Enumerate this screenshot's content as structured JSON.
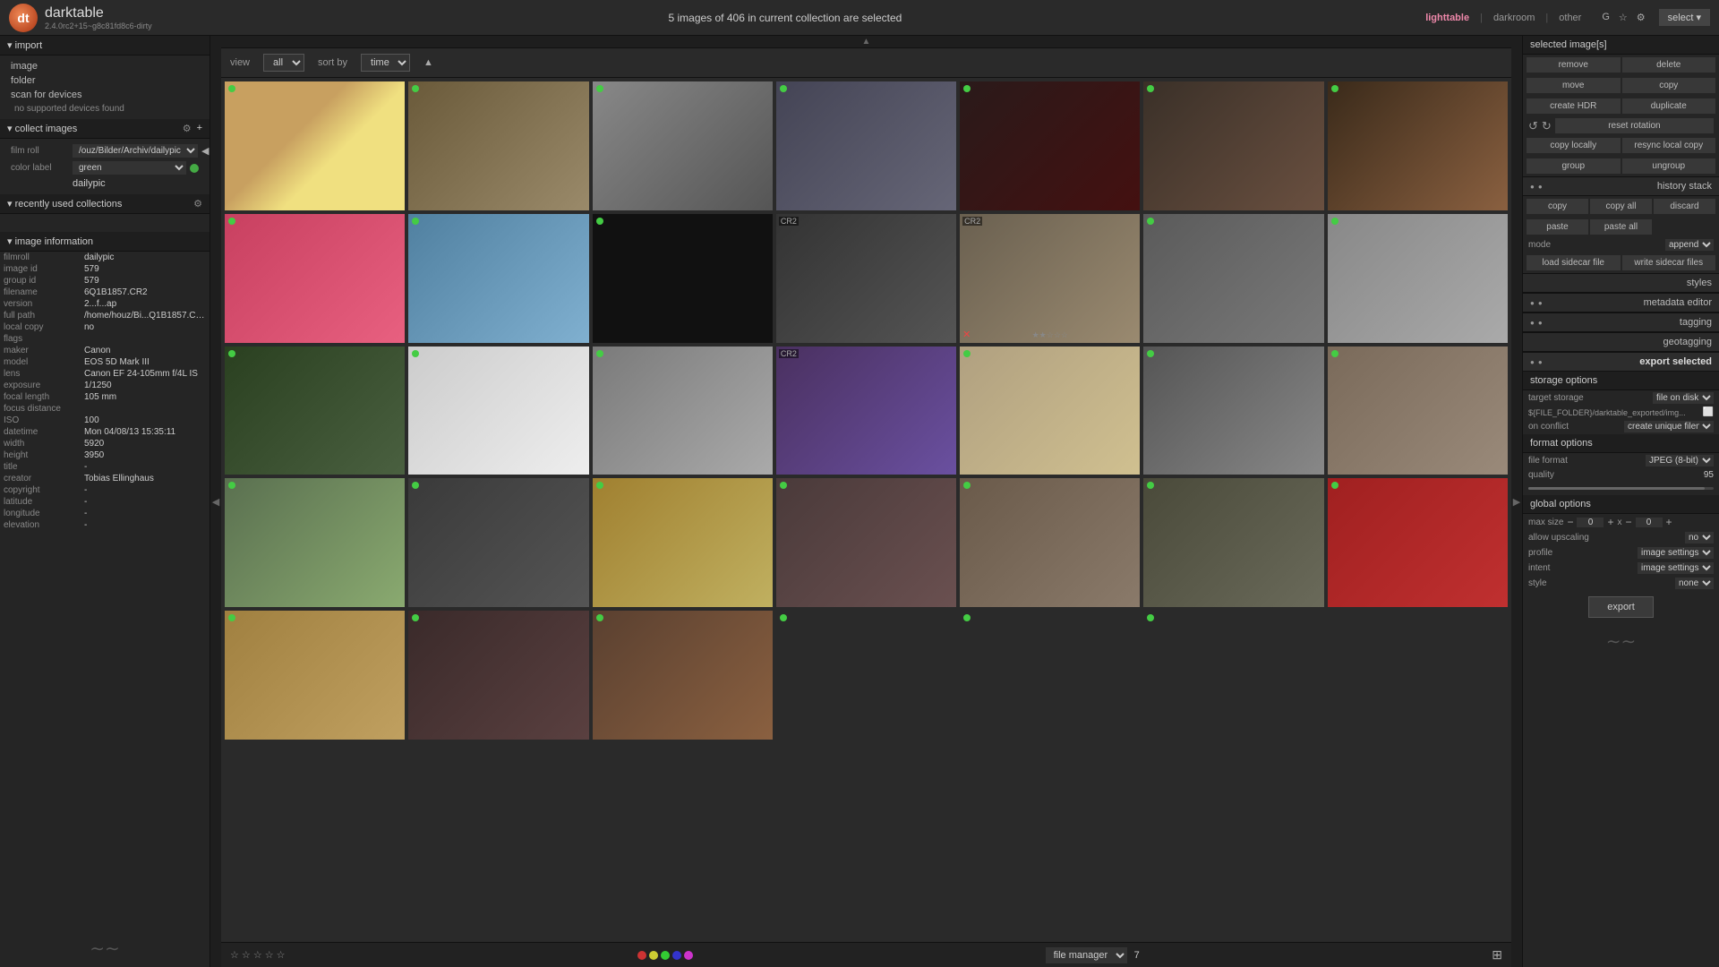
{
  "app": {
    "name": "darktable",
    "version": "2.4.0rc2+15~g8c81fd8c6-dirty"
  },
  "topbar": {
    "center": "5 images of 406 in current collection are selected",
    "modules": [
      "lighttable",
      "darkroom",
      "other"
    ],
    "active_module": "lighttable",
    "select_label": "select ▾"
  },
  "toolbar": {
    "view_label": "view",
    "view_value": "all",
    "sort_label": "sort by",
    "sort_value": "time"
  },
  "left": {
    "import_header": "▾ import",
    "import_items": [
      "image",
      "folder",
      "scan for devices",
      "no supported devices found"
    ],
    "collect_header": "▾ collect images",
    "film_roll_label": "film roll",
    "film_roll_value": "▾ /ouz/Bilder/Archiv/dailypic",
    "color_label_label": "color label",
    "color_label_value": "green",
    "tag_value": "dailypic",
    "recent_header": "▾ recently used collections",
    "image_info_header": "▾ image information",
    "info": {
      "filmroll": {
        "label": "filmroll",
        "value": "dailypic"
      },
      "image_id": {
        "label": "image id",
        "value": "579"
      },
      "group_id": {
        "label": "group id",
        "value": "579"
      },
      "filename": {
        "label": "filename",
        "value": "6Q1B1857.CR2"
      },
      "version": {
        "label": "version",
        "value": "2...f...ap"
      },
      "full_path": {
        "label": "full path",
        "value": "/home/houz/Bi...Q1B1857.CR2"
      },
      "local_copy": {
        "label": "local copy",
        "value": "no"
      },
      "flags": {
        "label": "flags",
        "value": ""
      },
      "maker": {
        "label": "maker",
        "value": "Canon"
      },
      "model": {
        "label": "model",
        "value": "EOS 5D Mark III"
      },
      "lens": {
        "label": "lens",
        "value": "Canon EF 24-105mm f/4L IS"
      },
      "exposure": {
        "label": "exposure",
        "value": "1/1250"
      },
      "focal_length": {
        "label": "focal length",
        "value": "105 mm"
      },
      "focus_distance": {
        "label": "focus distance",
        "value": ""
      },
      "iso": {
        "label": "ISO",
        "value": "100"
      },
      "datetime": {
        "label": "datetime",
        "value": "Mon 04/08/13 15:35:11"
      },
      "width": {
        "label": "width",
        "value": "5920"
      },
      "height": {
        "label": "height",
        "value": "3950"
      },
      "title": {
        "label": "title",
        "value": "-"
      },
      "creator": {
        "label": "creator",
        "value": "Tobias Ellinghaus"
      },
      "copyright": {
        "label": "copyright",
        "value": "-"
      },
      "latitude": {
        "label": "latitude",
        "value": "-"
      },
      "longitude": {
        "label": "longitude",
        "value": "-"
      },
      "elevation": {
        "label": "elevation",
        "value": "-"
      }
    }
  },
  "right": {
    "selected_label": "selected image[s]",
    "buttons": {
      "remove": "remove",
      "delete": "delete",
      "move": "move",
      "copy": "copy",
      "create_hdr": "create HDR",
      "duplicate": "duplicate",
      "copy_locally": "copy locally",
      "resync_local_copy": "resync local copy",
      "group": "group",
      "ungroup": "ungroup",
      "reset_rotation": "reset rotation"
    },
    "history_label": "history stack",
    "history_btns": {
      "copy": "copy",
      "copy_all": "copy all",
      "discard": "discard",
      "paste": "paste",
      "paste_all": "paste all"
    },
    "mode_label": "mode",
    "mode_value": "append",
    "load_sidecar": "load sidecar file",
    "write_sidecar": "write sidecar files",
    "styles_label": "styles",
    "metadata_label": "metadata editor",
    "tagging_label": "tagging",
    "geotagging_label": "geotagging",
    "export_label": "export selected",
    "storage_options_label": "storage options",
    "target_storage_label": "target storage",
    "target_storage_value": "file on disk",
    "file_folder_label": "${FILE_FOLDER}/darktable_exported/img...",
    "on_conflict_label": "on conflict",
    "on_conflict_value": "create unique filename",
    "format_options_label": "format options",
    "file_format_label": "file format",
    "file_format_value": "JPEG (8-bit)",
    "quality_label": "quality",
    "quality_value": "95",
    "global_options_label": "global options",
    "max_size_label": "max size",
    "max_size_w": "0",
    "max_size_h": "0",
    "allow_upscaling_label": "allow upscaling",
    "allow_upscaling_value": "no",
    "profile_label": "profile",
    "profile_value": "image settings",
    "intent_label": "intent",
    "intent_value": "image settings",
    "style_label": "style",
    "style_value": "none",
    "export_btn": "export"
  },
  "bottom": {
    "view_value": "file manager",
    "page": "7",
    "color_labels": [
      "red",
      "yellow",
      "green",
      "blue",
      "purple"
    ]
  },
  "photos": [
    {
      "id": 1,
      "color": "ph-egg",
      "selected": false,
      "green": true
    },
    {
      "id": 2,
      "color": "ph-owl",
      "selected": false,
      "green": true
    },
    {
      "id": 3,
      "color": "ph-hand",
      "selected": false,
      "green": true
    },
    {
      "id": 4,
      "color": "ph-city",
      "selected": false,
      "green": true
    },
    {
      "id": 5,
      "color": "ph-red",
      "selected": false,
      "green": true
    },
    {
      "id": 6,
      "color": "ph-deer",
      "selected": false,
      "green": true
    },
    {
      "id": 7,
      "color": "ph-face",
      "selected": false,
      "green": true
    },
    {
      "id": 8,
      "color": "ph-picks",
      "selected": false,
      "green": true
    },
    {
      "id": 9,
      "color": "ph-chain",
      "selected": false,
      "green": true
    },
    {
      "id": 10,
      "color": "ph-dark",
      "selected": false,
      "green": true
    },
    {
      "id": 11,
      "color": "ph-bike",
      "selected": false,
      "cr2": true
    },
    {
      "id": 12,
      "color": "ph-stone",
      "selected": false,
      "cr2": true
    },
    {
      "id": 13,
      "color": "ph-train",
      "selected": false,
      "green": true
    },
    {
      "id": 14,
      "color": "ph-sign",
      "selected": false,
      "green": true
    },
    {
      "id": 15,
      "color": "ph-fern",
      "selected": false,
      "green": true
    },
    {
      "id": 16,
      "color": "ph-sink",
      "selected": false,
      "green": true
    },
    {
      "id": 17,
      "color": "ph-crack",
      "selected": false,
      "green": true
    },
    {
      "id": 18,
      "color": "ph-hair",
      "selected": false,
      "cr2": true
    },
    {
      "id": 19,
      "color": "ph-clock",
      "selected": false,
      "green": true
    },
    {
      "id": 20,
      "color": "ph-arch-ph",
      "selected": false,
      "green": true
    },
    {
      "id": 21,
      "color": "ph-graffiti",
      "selected": false,
      "green": true
    },
    {
      "id": 22,
      "color": "ph-flower2",
      "selected": false,
      "green": true
    },
    {
      "id": 23,
      "color": "ph-pear",
      "selected": false,
      "green": true
    },
    {
      "id": 24,
      "color": "ph-drink",
      "selected": false,
      "green": true
    },
    {
      "id": 25,
      "color": "ph-arch",
      "selected": false,
      "green": true
    },
    {
      "id": 26,
      "color": "ph-ruins",
      "selected": false,
      "green": true
    },
    {
      "id": 27,
      "color": "ph-road",
      "selected": false,
      "green": true
    },
    {
      "id": 28,
      "color": "ph-tulip",
      "selected": false,
      "green": true
    },
    {
      "id": 29,
      "color": "ph-jar",
      "selected": false,
      "green": true
    },
    {
      "id": 30,
      "color": "ph-shell",
      "selected": false,
      "green": true
    },
    {
      "id": 31,
      "color": "ph-dog",
      "selected": false,
      "green": true
    },
    {
      "id": 32,
      "color": "ph-unknown",
      "selected": false,
      "green": true
    },
    {
      "id": 33,
      "color": "ph-unknown",
      "selected": false,
      "green": true
    },
    {
      "id": 34,
      "color": "ph-unknown",
      "selected": false,
      "green": true
    }
  ]
}
